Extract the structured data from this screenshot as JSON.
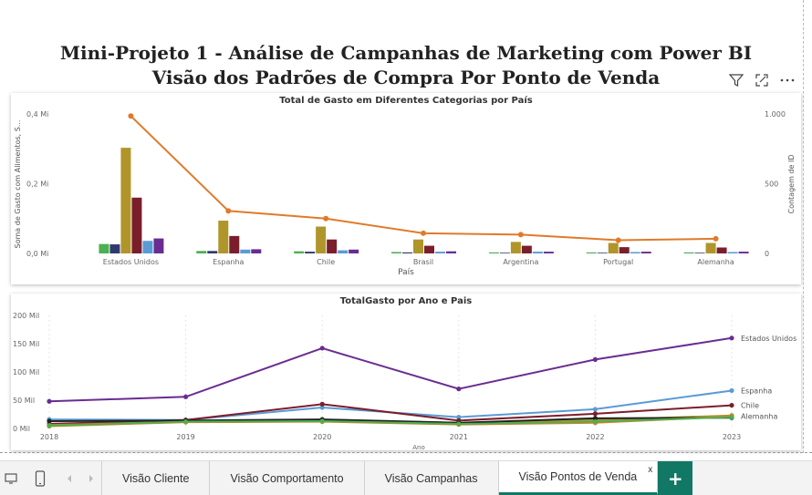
{
  "report": {
    "title_line1": "Mini-Projeto 1 - Análise de Campanhas de Marketing com Power BI",
    "title_line2": "Visão dos Padrões de Compra Por Ponto de Venda"
  },
  "toolbar": {
    "filter_icon": "filter-icon",
    "focus_icon": "focus-mode-icon",
    "more_icon": "more-options-icon"
  },
  "tabs": [
    {
      "label": "Visão Cliente"
    },
    {
      "label": "Visão Comportamento"
    },
    {
      "label": "Visão Campanhas"
    },
    {
      "label": "Visão Pontos de Venda",
      "active": true,
      "close": "x"
    }
  ],
  "add_tab_label": "+",
  "chart_data": [
    {
      "type": "bar",
      "title": "Total de Gasto em Diferentes Categorias por País",
      "xlabel": "País",
      "ylabel": "Soma de Gasto com Alimentos, S...",
      "y2label": "Contagem de ID",
      "ylim": [
        0,
        400000
      ],
      "y2lim": [
        0,
        1000
      ],
      "yticks": [
        "0,0 Mi",
        "0,2 Mi",
        "0,4 Mi"
      ],
      "y2ticks": [
        "0",
        "500",
        "1.000"
      ],
      "categories": [
        "Estados Unidos",
        "Espanha",
        "Chile",
        "Brasil",
        "Argentina",
        "Portugal",
        "Alemanha"
      ],
      "series_colors": [
        "#4caf50",
        "#2f3b6e",
        "#b0952a",
        "#7b1e2c",
        "#5b9bd5",
        "#6a2c91"
      ],
      "bar_series": [
        {
          "values": [
            27000,
            7000,
            6000,
            4000,
            3000,
            3000,
            3000
          ]
        },
        {
          "values": [
            26000,
            7000,
            5000,
            3000,
            2000,
            2000,
            2000
          ]
        },
        {
          "values": [
            303000,
            94000,
            77000,
            40000,
            33000,
            30000,
            30000
          ]
        },
        {
          "values": [
            160000,
            50000,
            40000,
            22000,
            22000,
            18000,
            17000
          ]
        },
        {
          "values": [
            36000,
            11000,
            9000,
            5000,
            5000,
            4000,
            4000
          ]
        },
        {
          "values": [
            43000,
            12000,
            11000,
            6000,
            5000,
            5000,
            5000
          ]
        }
      ],
      "line_series": {
        "color": "#e07a2a",
        "values": [
          985,
          305,
          250,
          145,
          135,
          95,
          105
        ]
      },
      "grid": false
    },
    {
      "type": "line",
      "title": "TotalGasto por Ano e Pais",
      "xlabel": "Ano",
      "ylabel": "",
      "x": [
        "2018",
        "2019",
        "2020",
        "2021",
        "2022",
        "2023"
      ],
      "ylim": [
        0,
        200000
      ],
      "yticks": [
        "0 Mil",
        "50 Mil",
        "100 Mil",
        "150 Mil",
        "200 Mil"
      ],
      "series": [
        {
          "name": "Estados Unidos",
          "color": "#6a2c91",
          "values": [
            48000,
            56000,
            142000,
            70000,
            122000,
            160000
          ]
        },
        {
          "name": "Espanha",
          "color": "#5b9bd5",
          "values": [
            16000,
            15000,
            37000,
            20000,
            34000,
            67000
          ]
        },
        {
          "name": "Chile",
          "color": "#7b1e2c",
          "values": [
            8000,
            15000,
            43000,
            14000,
            26000,
            41000
          ]
        },
        {
          "name": "Alemanha",
          "color": "#b0952a",
          "values": [
            6000,
            12000,
            15000,
            10000,
            15000,
            23000
          ]
        },
        {
          "color": "#222222",
          "values": [
            13000,
            14000,
            16000,
            10000,
            18000,
            19000
          ]
        },
        {
          "color": "#e07a2a",
          "values": [
            4000,
            11000,
            12000,
            7000,
            10000,
            21000
          ]
        },
        {
          "color": "#4caf50",
          "values": [
            5000,
            12000,
            13000,
            8000,
            12000,
            20000
          ]
        }
      ],
      "grid": false
    }
  ]
}
